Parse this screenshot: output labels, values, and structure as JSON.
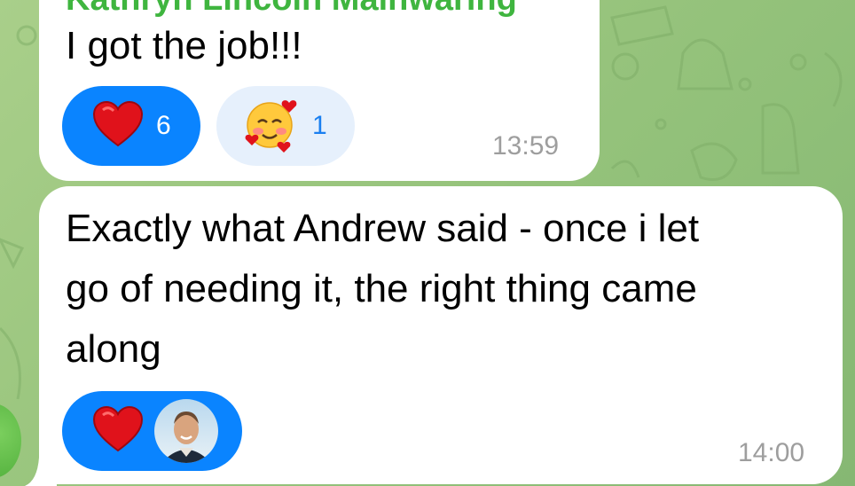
{
  "colors": {
    "sender_name": "#3fb53f",
    "reaction_active": "#0a84ff",
    "reaction_inactive": "#e6f0fc",
    "timestamp": "#9e9e9e",
    "bubble": "#ffffff",
    "background": "#9bc67f"
  },
  "messages": [
    {
      "sender": "Kathryn Lincoln Mainwaring",
      "text": "I got the job!!!",
      "reactions": [
        {
          "icon": "red-heart-icon",
          "count": "6",
          "active": true
        },
        {
          "icon": "smiling-face-with-hearts-icon",
          "count": "1",
          "active": false
        }
      ],
      "time": "13:59"
    },
    {
      "text_lines": [
        "Exactly what Andrew said - once i let",
        "go of needing it, the right thing came",
        "along"
      ],
      "reactions": [
        {
          "icon": "red-heart-icon",
          "avatar": "reactor-avatar",
          "active": true
        }
      ],
      "time": "14:00"
    }
  ]
}
